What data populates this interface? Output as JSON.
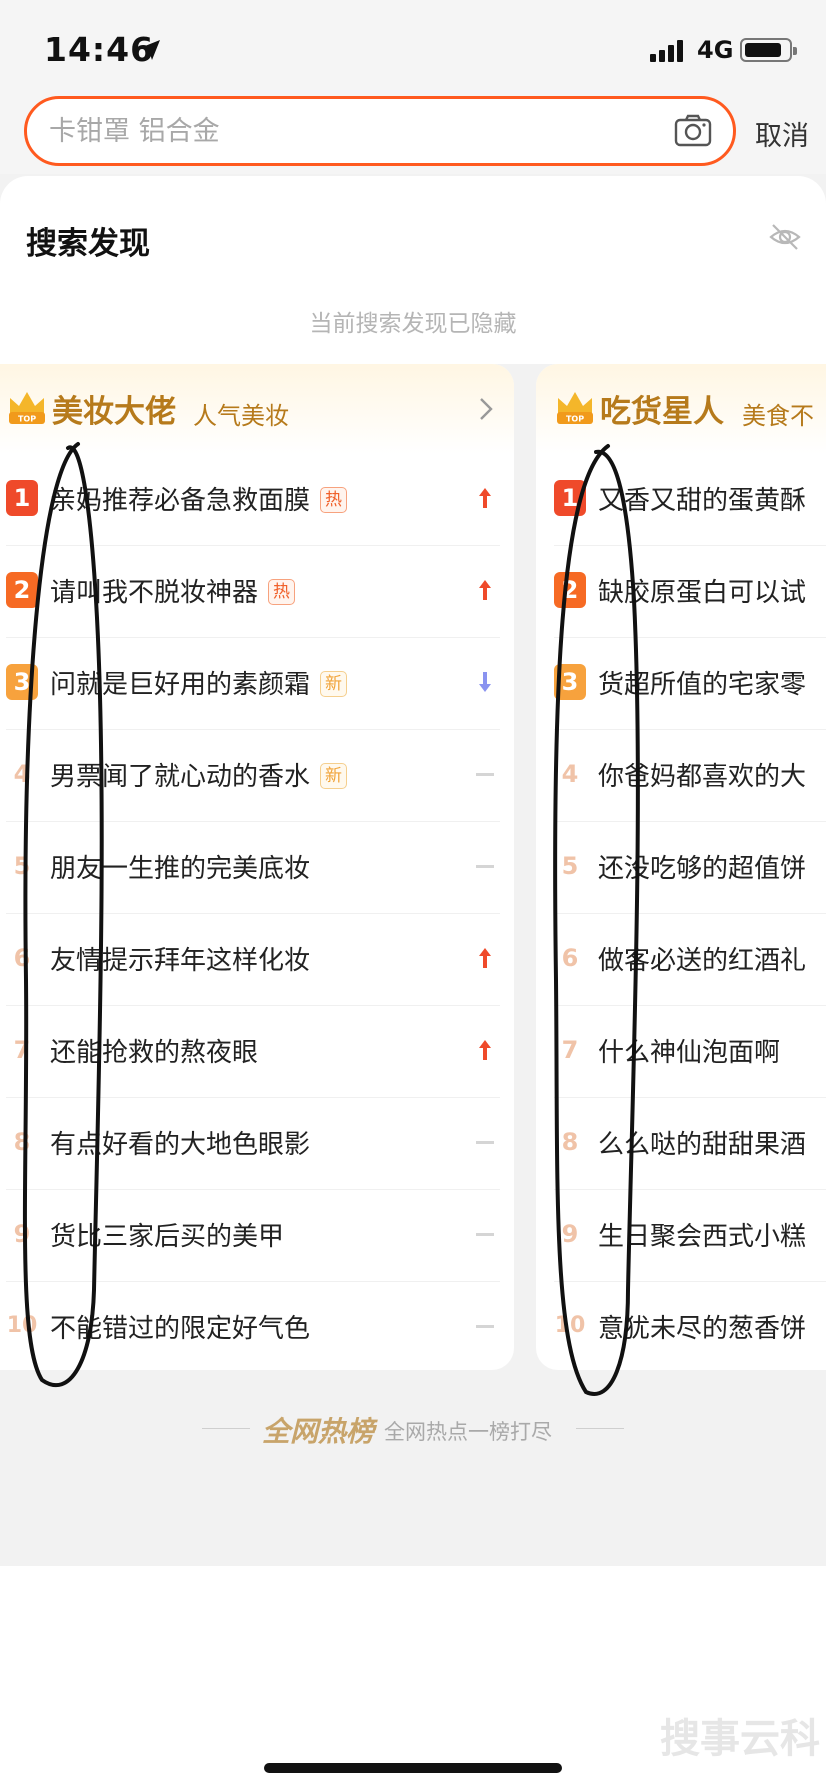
{
  "status_bar": {
    "time": "14:46",
    "network": "4G"
  },
  "search": {
    "placeholder": "卡钳罩 铝合金",
    "cancel_label": "取消"
  },
  "discover": {
    "title": "搜索发现",
    "hidden_note": "当前搜索发现已隐藏"
  },
  "boards": [
    {
      "title": "美妆大佬",
      "subtitle": "人气美妆",
      "items": [
        {
          "rank": "1",
          "text": "亲妈推荐必备急救面膜",
          "tag": "热",
          "trend": "up"
        },
        {
          "rank": "2",
          "text": "请叫我不脱妆神器",
          "tag": "热",
          "trend": "up"
        },
        {
          "rank": "3",
          "text": "问就是巨好用的素颜霜",
          "tag": "新",
          "trend": "down"
        },
        {
          "rank": "4",
          "text": "男票闻了就心动的香水",
          "tag": "新",
          "trend": "flat"
        },
        {
          "rank": "5",
          "text": "朋友一生推的完美底妆",
          "tag": "",
          "trend": "flat"
        },
        {
          "rank": "6",
          "text": "友情提示拜年这样化妆",
          "tag": "",
          "trend": "up"
        },
        {
          "rank": "7",
          "text": "还能抢救的熬夜眼",
          "tag": "",
          "trend": "up"
        },
        {
          "rank": "8",
          "text": "有点好看的大地色眼影",
          "tag": "",
          "trend": "flat"
        },
        {
          "rank": "9",
          "text": "货比三家后买的美甲",
          "tag": "",
          "trend": "flat"
        },
        {
          "rank": "10",
          "text": "不能错过的限定好气色",
          "tag": "",
          "trend": "flat"
        }
      ]
    },
    {
      "title": "吃货星人",
      "subtitle": "美食不",
      "items": [
        {
          "rank": "1",
          "text": "又香又甜的蛋黄酥"
        },
        {
          "rank": "2",
          "text": "缺胶原蛋白可以试"
        },
        {
          "rank": "3",
          "text": "货超所值的宅家零"
        },
        {
          "rank": "4",
          "text": "你爸妈都喜欢的大"
        },
        {
          "rank": "5",
          "text": "还没吃够的超值饼"
        },
        {
          "rank": "6",
          "text": "做客必送的红酒礼"
        },
        {
          "rank": "7",
          "text": "什么神仙泡面啊"
        },
        {
          "rank": "8",
          "text": "么么哒的甜甜果酒"
        },
        {
          "rank": "9",
          "text": "生日聚会西式小糕"
        },
        {
          "rank": "10",
          "text": "意犹未尽的葱香饼"
        }
      ]
    }
  ],
  "footer": {
    "brand": "全网热榜",
    "tagline": "全网热点一榜打尽"
  },
  "watermark": "搜事云科",
  "colors": {
    "accent": "#ff5a1f",
    "gold": "#b67a1b",
    "rank1": "#ef4a2a",
    "rank2": "#f66a24",
    "rank3": "#f7a23d",
    "trend_up": "#ef4a2a",
    "trend_down": "#8a93f0"
  }
}
